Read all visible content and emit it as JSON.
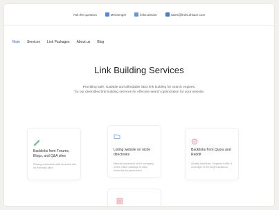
{
  "topbar": {
    "ask": "Ask the question",
    "messenger": "Messenger",
    "links": "links.ahsam",
    "email": "sales@links.ahsam.com"
  },
  "nav": [
    "Main",
    "Services",
    "Link Packages",
    "About us",
    "Blog"
  ],
  "hero": {
    "title": "Link Building Services",
    "line1": "Providing safe, scalable and affordable SEO link building for search engines.",
    "line2": "Try our diversified link building services for effective search optimization for your website."
  },
  "cards": [
    {
      "title": "Backlinks from Forums, Blogs, and Q&A sites",
      "desc": "Placing comments with an active link on thematic sites",
      "icon": "link-icon"
    },
    {
      "title": "Listing website on niche directories",
      "desc": "Manual placement of the company in the online catalogs of sites, branches by parameters",
      "icon": "folder-icon"
    },
    {
      "title": "Backlinks from Quora and Reddit",
      "desc": "Quality backlinks. Targeted traffic & coverage of the target audience",
      "icon": "chat-icon"
    },
    {
      "title": "",
      "desc": "",
      "icon": "grid-icon"
    }
  ],
  "colors": {
    "accent": "#2f6bd6",
    "topbar_icons": "#5b86d6"
  }
}
